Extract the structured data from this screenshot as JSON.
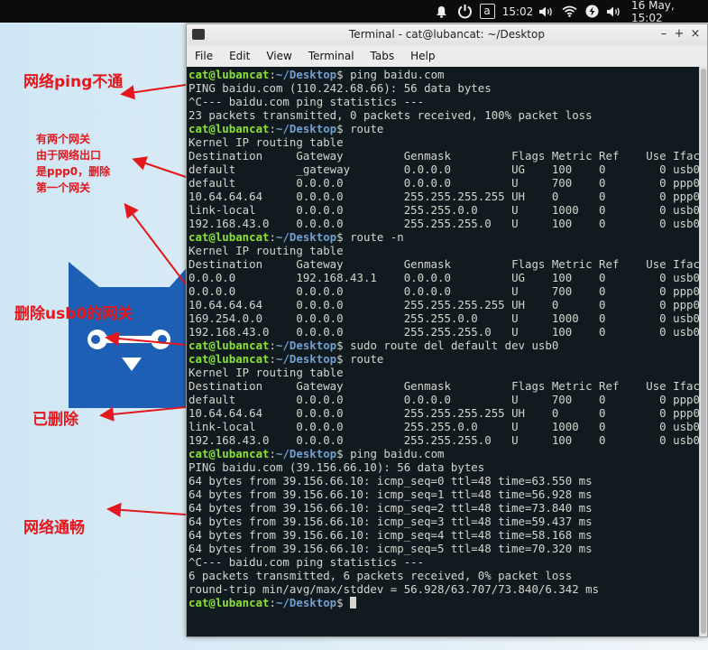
{
  "top_panel": {
    "clock": "15:02",
    "date_time": "16 May, 15:02",
    "keyboard_indicator": "a",
    "icons": [
      "bell-icon",
      "power-icon",
      "keyboard-icon",
      "volume-icon",
      "wifi-icon",
      "battery-charging-icon",
      "volume-icon"
    ]
  },
  "window": {
    "title": "Terminal - cat@lubancat: ~/Desktop",
    "controls": [
      "–",
      "+",
      "×"
    ]
  },
  "menu": [
    "File",
    "Edit",
    "View",
    "Terminal",
    "Tabs",
    "Help"
  ],
  "prompt": {
    "user": "cat@lubancat",
    "colon": ":",
    "path": "~/Desktop",
    "suffix": "$ "
  },
  "terminal_lines": [
    {
      "type": "prompt",
      "cmd": "ping baidu.com"
    },
    {
      "type": "out",
      "text": "PING baidu.com (110.242.68.66): 56 data bytes"
    },
    {
      "type": "out",
      "text": "^C--- baidu.com ping statistics ---"
    },
    {
      "type": "out",
      "text": "23 packets transmitted, 0 packets received, 100% packet loss"
    },
    {
      "type": "prompt",
      "cmd": "route"
    },
    {
      "type": "out",
      "text": "Kernel IP routing table"
    },
    {
      "type": "out",
      "text": "Destination     Gateway         Genmask         Flags Metric Ref    Use Iface"
    },
    {
      "type": "out",
      "text": "default         _gateway        0.0.0.0         UG    100    0        0 usb0"
    },
    {
      "type": "out",
      "text": "default         0.0.0.0         0.0.0.0         U     700    0        0 ppp0"
    },
    {
      "type": "out",
      "text": "10.64.64.64     0.0.0.0         255.255.255.255 UH    0      0        0 ppp0"
    },
    {
      "type": "out",
      "text": "link-local      0.0.0.0         255.255.0.0     U     1000   0        0 usb0"
    },
    {
      "type": "out",
      "text": "192.168.43.0    0.0.0.0         255.255.255.0   U     100    0        0 usb0"
    },
    {
      "type": "prompt",
      "cmd": "route -n"
    },
    {
      "type": "out",
      "text": "Kernel IP routing table"
    },
    {
      "type": "out",
      "text": "Destination     Gateway         Genmask         Flags Metric Ref    Use Iface"
    },
    {
      "type": "out",
      "text": "0.0.0.0         192.168.43.1    0.0.0.0         UG    100    0        0 usb0"
    },
    {
      "type": "out",
      "text": "0.0.0.0         0.0.0.0         0.0.0.0         U     700    0        0 ppp0"
    },
    {
      "type": "out",
      "text": "10.64.64.64     0.0.0.0         255.255.255.255 UH    0      0        0 ppp0"
    },
    {
      "type": "out",
      "text": "169.254.0.0     0.0.0.0         255.255.0.0     U     1000   0        0 usb0"
    },
    {
      "type": "out",
      "text": "192.168.43.0    0.0.0.0         255.255.255.0   U     100    0        0 usb0"
    },
    {
      "type": "prompt",
      "cmd": "sudo route del default dev usb0"
    },
    {
      "type": "prompt",
      "cmd": "route"
    },
    {
      "type": "out",
      "text": "Kernel IP routing table"
    },
    {
      "type": "out",
      "text": "Destination     Gateway         Genmask         Flags Metric Ref    Use Iface"
    },
    {
      "type": "out",
      "text": "default         0.0.0.0         0.0.0.0         U     700    0        0 ppp0"
    },
    {
      "type": "out",
      "text": "10.64.64.64     0.0.0.0         255.255.255.255 UH    0      0        0 ppp0"
    },
    {
      "type": "out",
      "text": "link-local      0.0.0.0         255.255.0.0     U     1000   0        0 usb0"
    },
    {
      "type": "out",
      "text": "192.168.43.0    0.0.0.0         255.255.255.0   U     100    0        0 usb0"
    },
    {
      "type": "prompt",
      "cmd": "ping baidu.com"
    },
    {
      "type": "out",
      "text": "PING baidu.com (39.156.66.10): 56 data bytes"
    },
    {
      "type": "out",
      "text": "64 bytes from 39.156.66.10: icmp_seq=0 ttl=48 time=63.550 ms"
    },
    {
      "type": "out",
      "text": "64 bytes from 39.156.66.10: icmp_seq=1 ttl=48 time=56.928 ms"
    },
    {
      "type": "out",
      "text": "64 bytes from 39.156.66.10: icmp_seq=2 ttl=48 time=73.840 ms"
    },
    {
      "type": "out",
      "text": "64 bytes from 39.156.66.10: icmp_seq=3 ttl=48 time=59.437 ms"
    },
    {
      "type": "out",
      "text": "64 bytes from 39.156.66.10: icmp_seq=4 ttl=48 time=58.168 ms"
    },
    {
      "type": "out",
      "text": "64 bytes from 39.156.66.10: icmp_seq=5 ttl=48 time=70.320 ms"
    },
    {
      "type": "out",
      "text": "^C--- baidu.com ping statistics ---"
    },
    {
      "type": "out",
      "text": "6 packets transmitted, 6 packets received, 0% packet loss"
    },
    {
      "type": "out",
      "text": "round-trip min/avg/max/stddev = 56.928/63.707/73.840/6.342 ms"
    },
    {
      "type": "prompt",
      "cmd": "",
      "cursor": true
    }
  ],
  "annotations": {
    "ping_fail": "网络ping不通",
    "two_gateways": [
      "有两个网关",
      "由于网络出口",
      "是ppp0，删除",
      "第一个网关"
    ],
    "delete_gateway": "删除usb0的网关",
    "deleted": "已删除",
    "ping_ok": "网络通畅"
  },
  "colors": {
    "annotation": "#e3171c",
    "prompt_user": "#8ae234",
    "prompt_path": "#729fcf",
    "terminal_bg": "#111a1f",
    "mascot_blue": "#1d5fb4"
  }
}
